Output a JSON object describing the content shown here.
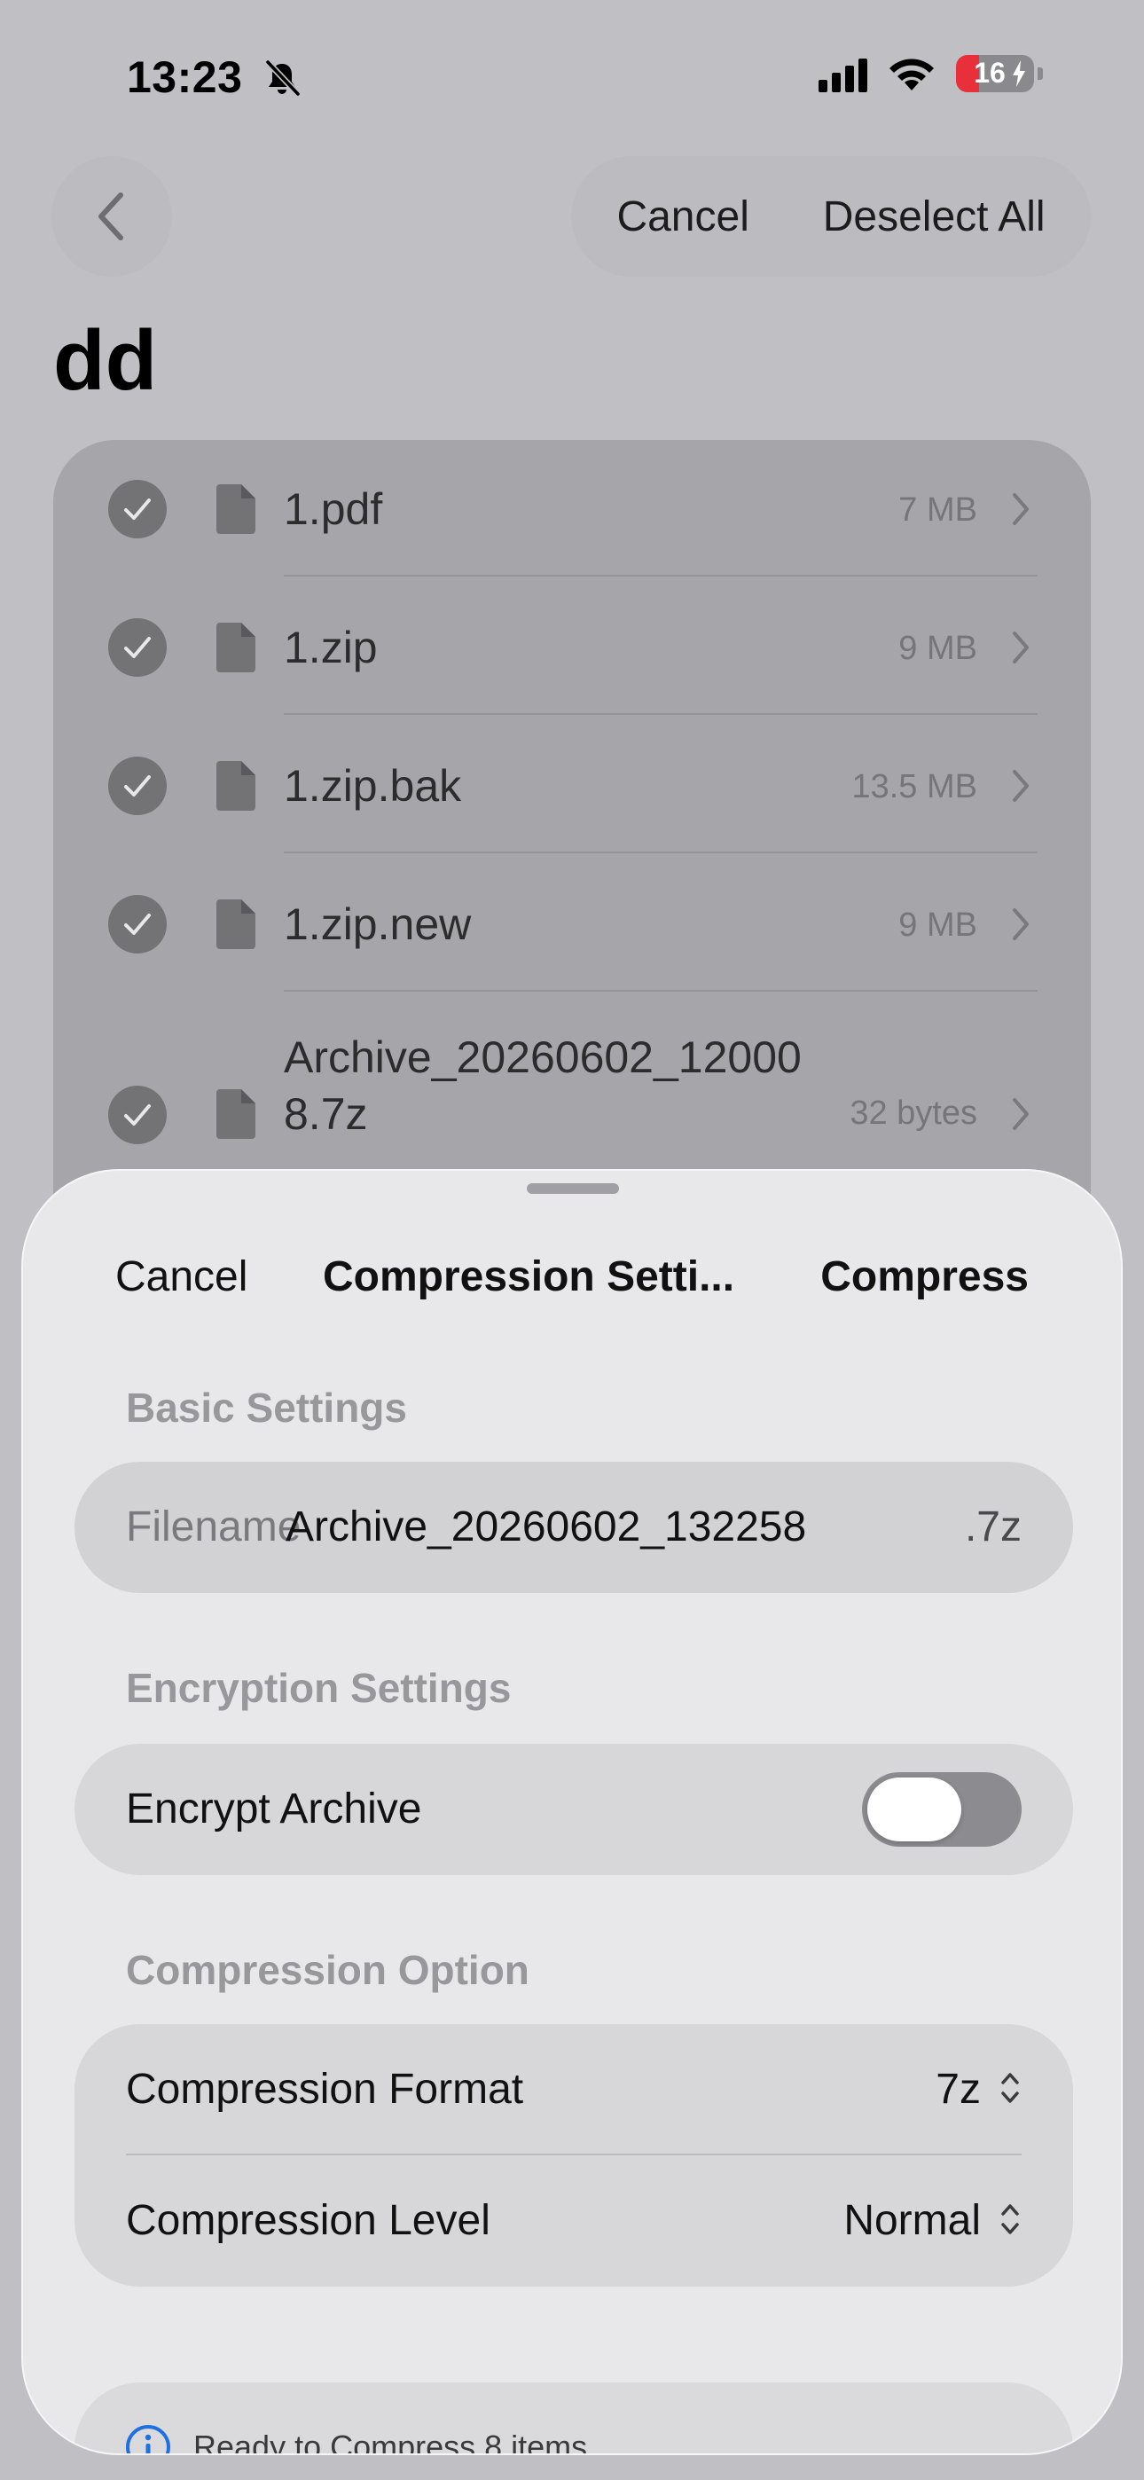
{
  "status_bar": {
    "time": "13:23",
    "battery": "16"
  },
  "nav": {
    "cancel": "Cancel",
    "deselect_all": "Deselect All"
  },
  "folder": {
    "title": "dd"
  },
  "files": [
    {
      "name": "1.pdf",
      "size": "7 MB"
    },
    {
      "name": "1.zip",
      "size": "9 MB"
    },
    {
      "name": "1.zip.bak",
      "size": "13.5 MB"
    },
    {
      "name": "1.zip.new",
      "size": "9 MB"
    },
    {
      "name_line1": "Archive_20260602_12000",
      "name_line2": "8.7z",
      "size": "32 bytes"
    }
  ],
  "sheet": {
    "cancel": "Cancel",
    "title": "Compression Setti...",
    "compress": "Compress",
    "basic_settings": {
      "label": "Basic Settings",
      "filename_label": "Filename",
      "filename_value": "Archive_20260602_132258",
      "extension": ".7z"
    },
    "encryption_settings": {
      "label": "Encryption Settings",
      "encrypt_label": "Encrypt Archive",
      "encrypt_enabled": false
    },
    "compression_option": {
      "label": "Compression Option",
      "format_label": "Compression Format",
      "format_value": "7z",
      "level_label": "Compression Level",
      "level_value": "Normal"
    },
    "info": {
      "text": "Ready to Compress 8 items"
    }
  },
  "colors": {
    "background": "#c0c0c4",
    "sheet": "#e8e8ea",
    "card": "#d7d7da",
    "battery_low": "#e8303a",
    "check": "#737376"
  }
}
